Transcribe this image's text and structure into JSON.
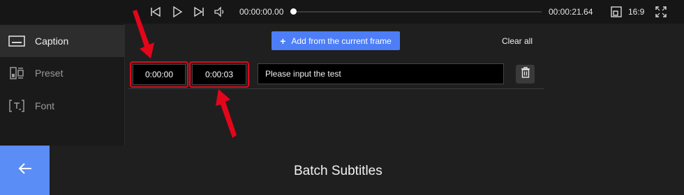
{
  "player": {
    "current_time": "00:00:00.00",
    "total_time": "00:00:21.64",
    "progress": 0,
    "aspect_ratio": "16:9",
    "icons": [
      "skip-back-icon",
      "play-icon",
      "skip-forward-icon",
      "volume-icon",
      "aspect-ratio-icon",
      "fullscreen-icon"
    ]
  },
  "sidebar": {
    "items": [
      {
        "label": "Caption",
        "icon": "caption-icon",
        "active": true
      },
      {
        "label": "Preset",
        "icon": "preset-icon",
        "active": false
      },
      {
        "label": "Font",
        "icon": "font-icon",
        "active": false
      }
    ]
  },
  "main": {
    "add_button": "Add from the current frame",
    "clear_all": "Clear all",
    "rows": [
      {
        "start": "0:00:00",
        "end": "0:00:03",
        "text": "Please input the test"
      }
    ]
  },
  "footer": {
    "title": "Batch Subtitles"
  },
  "colors": {
    "accent": "#4d7ef7",
    "back_button": "#5b8df7",
    "highlight": "#e3061b"
  }
}
